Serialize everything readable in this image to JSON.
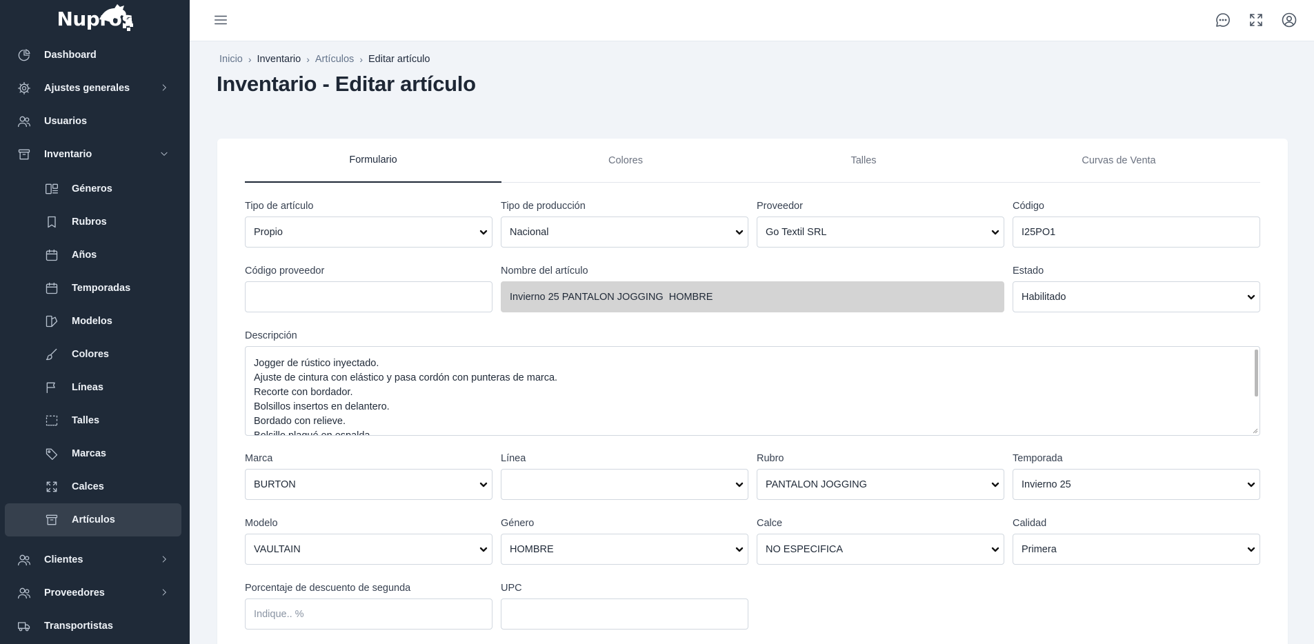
{
  "app": {
    "logo_text": "Nupros"
  },
  "sidebar": {
    "items": [
      {
        "label": "Dashboard",
        "icon": "pie-chart-icon"
      },
      {
        "label": "Ajustes generales",
        "icon": "gear-icon",
        "chevron": "right"
      },
      {
        "label": "Usuarios",
        "icon": "users-icon"
      },
      {
        "label": "Inventario",
        "icon": "archive-icon",
        "chevron": "down"
      }
    ],
    "inventario_sub": [
      {
        "label": "Géneros",
        "icon": "layout-icon"
      },
      {
        "label": "Rubros",
        "icon": "bookmark-icon"
      },
      {
        "label": "Años",
        "icon": "calendar-icon"
      },
      {
        "label": "Temporadas",
        "icon": "calendar-icon"
      },
      {
        "label": "Modelos",
        "icon": "shapes-icon"
      },
      {
        "label": "Colores",
        "icon": "brush-icon"
      },
      {
        "label": "Líneas",
        "icon": "flag-icon"
      },
      {
        "label": "Talles",
        "icon": "dashed-frame-icon"
      },
      {
        "label": "Marcas",
        "icon": "tag-icon"
      },
      {
        "label": "Calces",
        "icon": "expand-icon"
      },
      {
        "label": "Artículos",
        "icon": "archive-icon",
        "active": true
      }
    ],
    "bottom_items": [
      {
        "label": "Clientes",
        "icon": "users-icon",
        "chevron": "right"
      },
      {
        "label": "Proveedores",
        "icon": "users-icon",
        "chevron": "right"
      },
      {
        "label": "Transportistas",
        "icon": "truck-icon"
      }
    ]
  },
  "breadcrumb": {
    "home": "Inicio",
    "section": "Inventario",
    "list": "Artículos",
    "current": "Editar artículo"
  },
  "page": {
    "title": "Inventario - Editar artículo"
  },
  "tabs": [
    "Formulario",
    "Colores",
    "Talles",
    "Curvas de Venta"
  ],
  "form": {
    "tipo_articulo": {
      "label": "Tipo de artículo",
      "value": "Propio"
    },
    "tipo_produccion": {
      "label": "Tipo de producción",
      "value": "Nacional"
    },
    "proveedor": {
      "label": "Proveedor",
      "value": "Go Textil SRL"
    },
    "codigo": {
      "label": "Código",
      "value": "I25PO1"
    },
    "codigo_proveedor": {
      "label": "Código proveedor",
      "value": ""
    },
    "nombre": {
      "label": "Nombre del artículo",
      "value": "Invierno 25 PANTALON JOGGING  HOMBRE"
    },
    "estado": {
      "label": "Estado",
      "value": "Habilitado"
    },
    "descripcion": {
      "label": "Descripción",
      "lines": [
        "Jogger de rústico inyectado.",
        "Ajuste de cintura con elástico y pasa cordón con punteras de marca.",
        "Recorte con bordador.",
        "Bolsillos insertos en delantero.",
        "Bordado con relieve.",
        "Bolsillo plaqué en espalda."
      ]
    },
    "marca": {
      "label": "Marca",
      "value": "BURTON"
    },
    "linea": {
      "label": "Línea",
      "value": ""
    },
    "rubro": {
      "label": "Rubro",
      "value": "PANTALON JOGGING"
    },
    "temporada": {
      "label": "Temporada",
      "value": "Invierno 25"
    },
    "modelo": {
      "label": "Modelo",
      "value": "VAULTAIN"
    },
    "genero": {
      "label": "Género",
      "value": "HOMBRE"
    },
    "calce": {
      "label": "Calce",
      "value": "NO ESPECIFICA"
    },
    "calidad": {
      "label": "Calidad",
      "value": "Primera"
    },
    "porcentaje": {
      "label": "Porcentaje de descuento de segunda",
      "placeholder": "Indique.. %"
    },
    "upc": {
      "label": "UPC",
      "value": ""
    }
  }
}
